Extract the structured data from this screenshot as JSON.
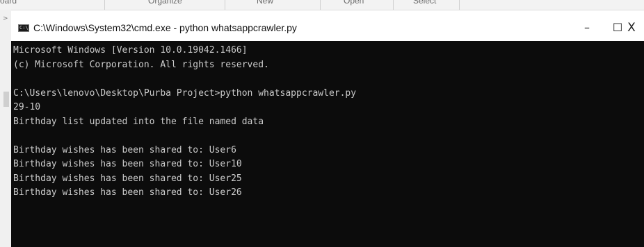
{
  "background_ribbon": {
    "items": [
      "oard",
      "Organize",
      "New",
      "Open",
      "Select"
    ]
  },
  "window": {
    "title": "C:\\Windows\\System32\\cmd.exe - python  whatsappcrawler.py",
    "icon": "cmd-icon",
    "icon_glyph": "C:\\",
    "controls": {
      "minimize": "–",
      "maximize": "☐",
      "close": "X"
    }
  },
  "console": {
    "lines": [
      "Microsoft Windows [Version 10.0.19042.1466]",
      "(c) Microsoft Corporation. All rights reserved.",
      "",
      "C:\\Users\\lenovo\\Desktop\\Purba Project>python whatsappcrawler.py",
      "29-10",
      "Birthday list updated into the file named data",
      "",
      "Birthday wishes has been shared to: User6",
      "Birthday wishes has been shared to: User10",
      "Birthday wishes has been shared to: User25",
      "Birthday wishes has been shared to: User26"
    ]
  },
  "colors": {
    "console_bg": "#0c0c0c",
    "console_fg": "#cccccc",
    "titlebar_bg": "#ffffff"
  }
}
